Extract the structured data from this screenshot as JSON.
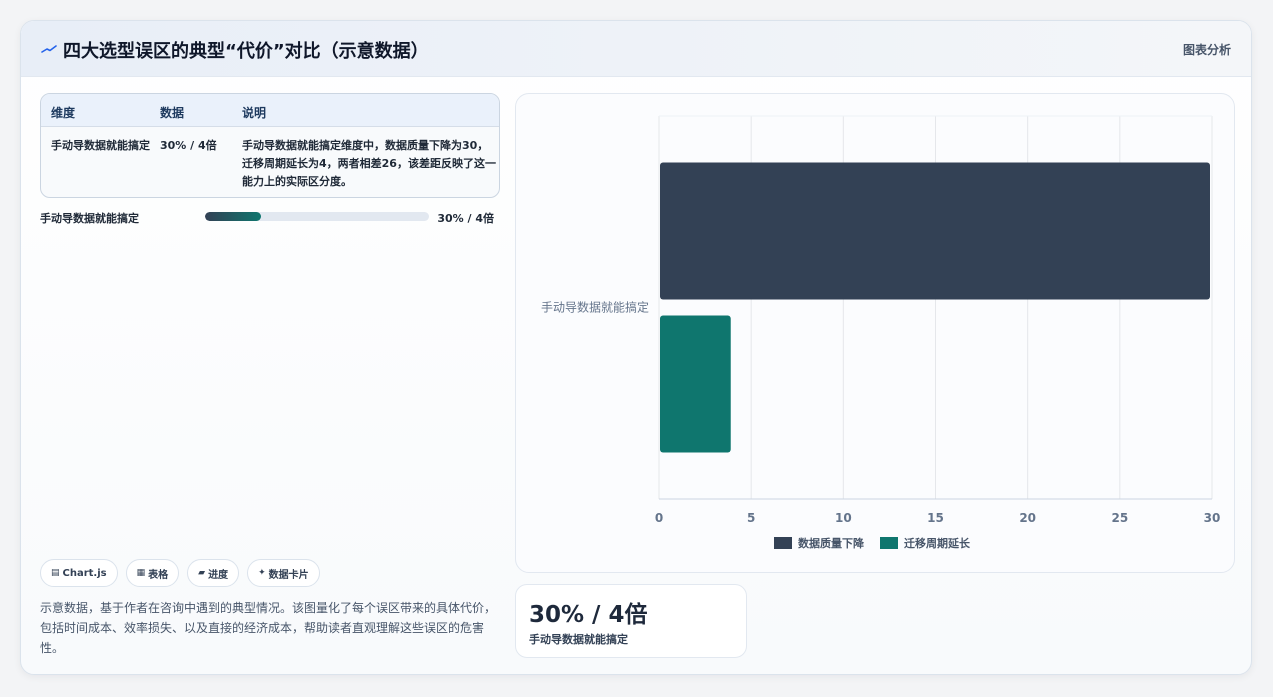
{
  "header": {
    "title": "四大选型误区的典型“代价”对比（示意数据）",
    "tag": "图表分析",
    "icon": "trend-line-icon"
  },
  "table": {
    "headers": [
      "维度",
      "数据",
      "说明"
    ],
    "rows": [
      {
        "dimension": "手动导数据就能搞定",
        "data": "30% / 4倍",
        "note": "手动导数据就能搞定维度中，数据质量下降为30，迁移周期延长为4，两者相差26，该差距反映了这一能力上的实际区分度。"
      }
    ]
  },
  "progress": {
    "label": "手动导数据就能搞定",
    "value_text": "30% / 4倍",
    "fraction": 0.25
  },
  "chips": [
    {
      "icon": "▤",
      "label": "Chart.js"
    },
    {
      "icon": "▦",
      "label": "表格"
    },
    {
      "icon": "▰",
      "label": "进度"
    },
    {
      "icon": "✦",
      "label": "数据卡片"
    }
  ],
  "description": "示意数据，基于作者在咨询中遇到的典型情况。该图量化了每个误区带来的具体代价，包括时间成本、效率损失、以及直接的经济成本，帮助读者直观理解这些误区的危害性。",
  "stat": {
    "value": "30% / 4倍",
    "label": "手动导数据就能搞定"
  },
  "colors": {
    "series1": "#334155",
    "series2": "#0f766e",
    "accent": "#1e3a5f"
  },
  "chart_data": {
    "type": "bar",
    "orientation": "horizontal",
    "categories": [
      "手动导数据就能搞定"
    ],
    "series": [
      {
        "name": "数据质量下降",
        "values": [
          30
        ]
      },
      {
        "name": "迁移周期延长",
        "values": [
          4
        ]
      }
    ],
    "xlim": [
      0,
      30
    ],
    "xticks": [
      0,
      5,
      10,
      15,
      20,
      25,
      30
    ],
    "grid": true,
    "legend": "bottom"
  }
}
